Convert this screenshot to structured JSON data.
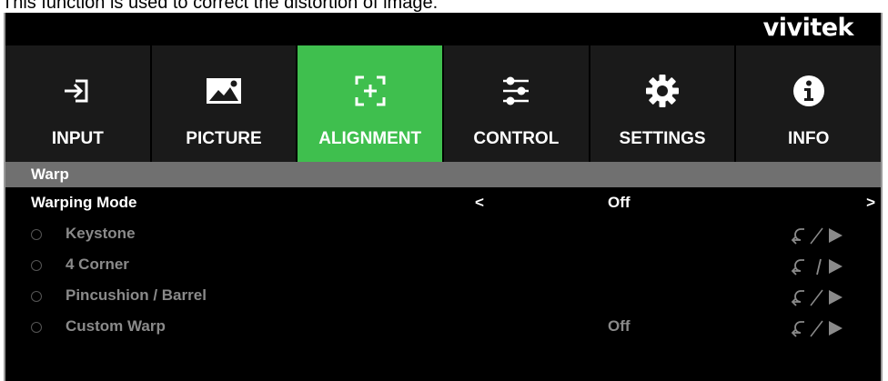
{
  "caption": "This function is used to correct the distortion of image.",
  "brand": "vivitek",
  "tabs": [
    {
      "label": "INPUT",
      "icon": "input-icon",
      "active": false
    },
    {
      "label": "PICTURE",
      "icon": "picture-icon",
      "active": false
    },
    {
      "label": "ALIGNMENT",
      "icon": "alignment-icon",
      "active": true
    },
    {
      "label": "CONTROL",
      "icon": "control-icon",
      "active": false
    },
    {
      "label": "SETTINGS",
      "icon": "gear-icon",
      "active": false
    },
    {
      "label": "INFO",
      "icon": "info-icon",
      "active": false
    }
  ],
  "section": "Warp",
  "warping_mode": {
    "label": "Warping Mode",
    "left_arrow": "<",
    "value": "Off",
    "right_arrow": ">"
  },
  "items": [
    {
      "label": "Keystone",
      "value": ""
    },
    {
      "label": "4 Corner",
      "value": ""
    },
    {
      "label": "Pincushion / Barrel",
      "value": ""
    },
    {
      "label": "Custom Warp",
      "value": "Off"
    }
  ],
  "colors": {
    "active_tab": "#3fbf4e",
    "tab_bg": "#1a1a1a",
    "section_bar": "#707070",
    "disabled_text": "#8a8a8a"
  }
}
